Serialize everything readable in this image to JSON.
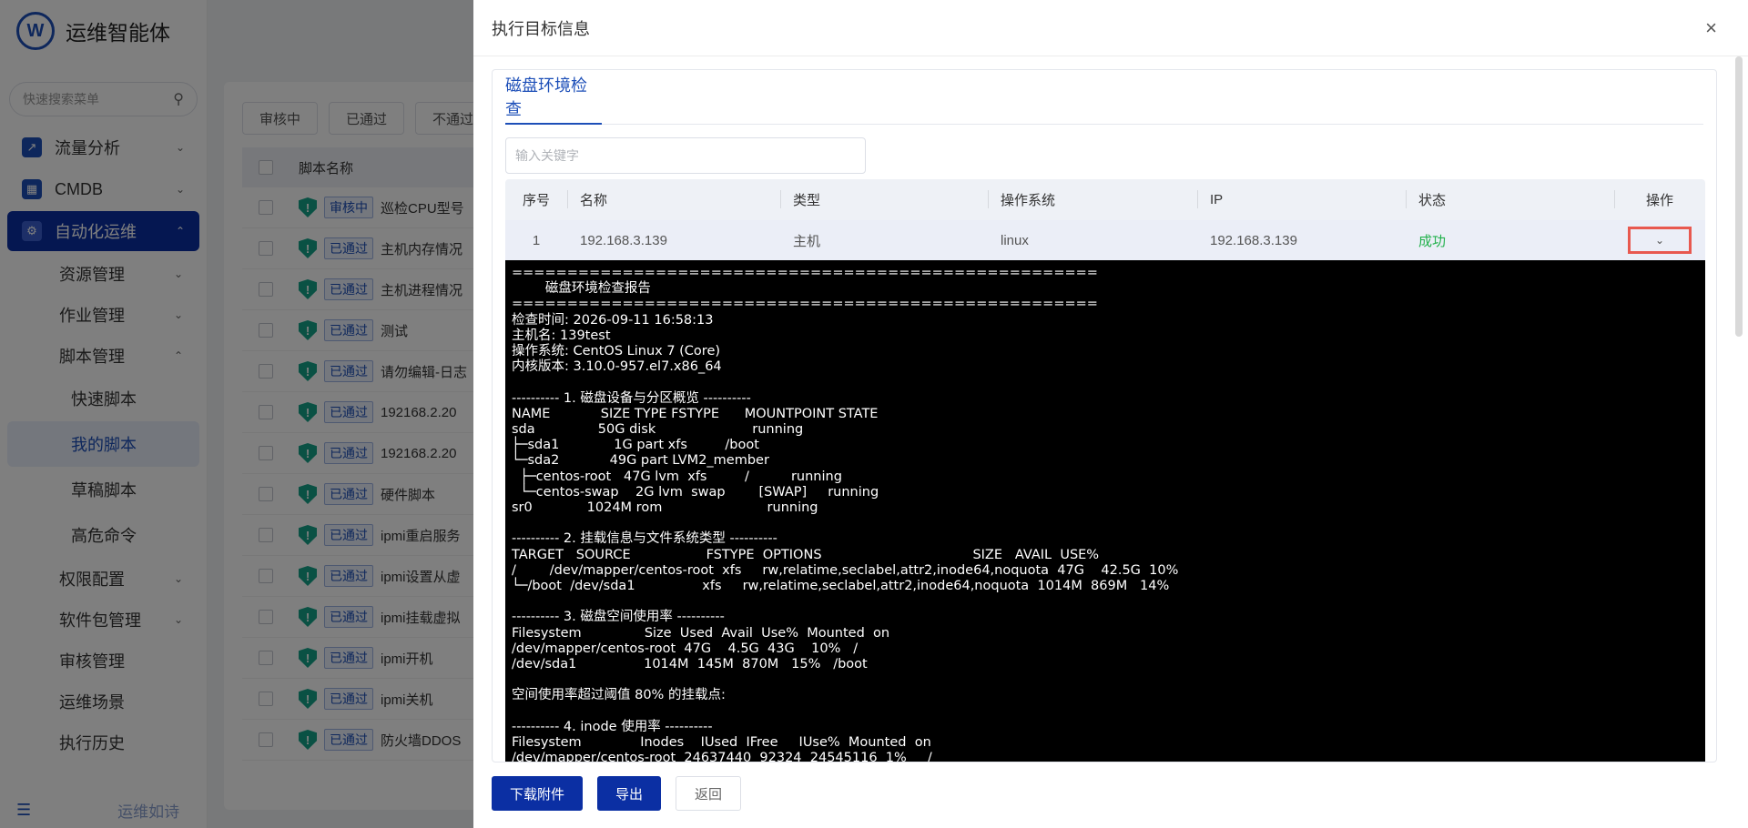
{
  "app": {
    "title": "运维智能体",
    "logo_text": "W",
    "footer_motto": "运维如诗"
  },
  "sidebar": {
    "search_placeholder": "快速搜索菜单",
    "items": [
      {
        "label": "流量分析",
        "icon_color": "#1d4fb8"
      },
      {
        "label": "CMDB",
        "icon_color": "#1d4fb8"
      },
      {
        "label": "自动化运维",
        "icon_color": "#ffffff"
      }
    ],
    "sub_items": [
      "资源管理",
      "作业管理",
      "脚本管理"
    ],
    "script_items": [
      "快速脚本",
      "我的脚本",
      "草稿脚本",
      "高危命令"
    ],
    "more_items": [
      "权限配置",
      "软件包管理",
      "审核管理",
      "运维场景",
      "执行历史"
    ]
  },
  "main": {
    "filter_tabs": [
      "审核中",
      "已通过",
      "不通过"
    ],
    "table_header": "脚本名称",
    "rows": [
      {
        "badge": "审核中",
        "name": "巡检CPU型号"
      },
      {
        "badge": "已通过",
        "name": "主机内存情况"
      },
      {
        "badge": "已通过",
        "name": "主机进程情况"
      },
      {
        "badge": "已通过",
        "name": "测试"
      },
      {
        "badge": "已通过",
        "name": "请勿编辑-日志"
      },
      {
        "badge": "已通过",
        "name": "192168.2.20"
      },
      {
        "badge": "已通过",
        "name": "192168.2.20"
      },
      {
        "badge": "已通过",
        "name": "硬件脚本"
      },
      {
        "badge": "已通过",
        "name": "ipmi重启服务"
      },
      {
        "badge": "已通过",
        "name": "ipmi设置从虚"
      },
      {
        "badge": "已通过",
        "name": "ipmi挂载虚拟"
      },
      {
        "badge": "已通过",
        "name": "ipmi开机"
      },
      {
        "badge": "已通过",
        "name": "ipmi关机"
      },
      {
        "badge": "已通过",
        "name": "防火墙DDOS"
      }
    ]
  },
  "drawer": {
    "title": "执行目标信息",
    "tab_label": "磁盘环境检查",
    "search_placeholder": "输入关键字",
    "columns": [
      "序号",
      "名称",
      "类型",
      "操作系统",
      "IP",
      "状态",
      "操作"
    ],
    "row": {
      "index": "1",
      "name": "192.168.3.139",
      "type": "主机",
      "os": "linux",
      "ip": "192.168.3.139",
      "status": "成功"
    },
    "output": "=====================================================\n        磁盘环境检查报告\n=====================================================\n检查时间: 2026-09-11 16:58:13\n主机名: 139test\n操作系统: CentOS Linux 7 (Core)\n内核版本: 3.10.0-957.el7.x86_64\n\n---------- 1. 磁盘设备与分区概览 ----------\nNAME            SIZE TYPE FSTYPE      MOUNTPOINT STATE\nsda               50G disk                       running\n├─sda1             1G part xfs         /boot\n└─sda2            49G part LVM2_member\n  ├─centos-root   47G lvm  xfs         /          running\n  └─centos-swap    2G lvm  swap        [SWAP]     running\nsr0             1024M rom                         running\n\n---------- 2. 挂载信息与文件系统类型 ----------\nTARGET   SOURCE                  FSTYPE  OPTIONS                                    SIZE   AVAIL  USE%\n/        /dev/mapper/centos-root  xfs     rw,relatime,seclabel,attr2,inode64,noquota  47G    42.5G  10%\n└─/boot  /dev/sda1                xfs     rw,relatime,seclabel,attr2,inode64,noquota  1014M  869M   14%\n\n---------- 3. 磁盘空间使用率 ----------\nFilesystem               Size  Used  Avail  Use%  Mounted  on\n/dev/mapper/centos-root  47G    4.5G  43G    10%   /\n/dev/sda1                1014M  145M  870M   15%   /boot\n\n空间使用率超过阈值 80% 的挂载点:\n\n---------- 4. inode 使用率 ----------\nFilesystem              Inodes    IUsed  IFree     IUse%  Mounted  on\n/dev/mapper/centos-root  24637440  92324  24545116  1%     /",
    "buttons": {
      "download": "下载附件",
      "export": "导出",
      "back": "返回"
    }
  },
  "colors": {
    "primary": "#0b2fa3",
    "success": "#22b14c",
    "highlight": "#e8584f"
  }
}
